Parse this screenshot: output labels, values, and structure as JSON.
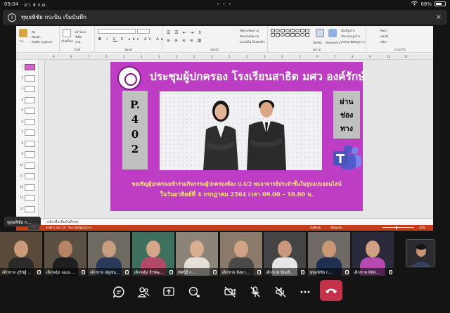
{
  "status_bar": {
    "time": "09:04",
    "date": "อา. 4 ก.ค.",
    "battery": "68%",
    "battery_level": 0.68
  },
  "banner": {
    "text": "ทุทฺธพิชัย กระบิน เริ่มบันทึก",
    "icon": "info-icon",
    "close": "×"
  },
  "ribbon": {
    "clipboard": {
      "paste": "วาง",
      "cut": "ตัด",
      "copy": "คัดลอก",
      "format_painter": "ตัวคัดวางรูปแบบ"
    },
    "slides": {
      "new_slide": "สไลด์ใหม่",
      "layout": "เค้าโครง",
      "reset": "รีเซ็ต",
      "section": "ส่วน",
      "label": "สไลด์"
    },
    "font": {
      "label": "ฟอนต์",
      "buttons": [
        "B",
        "I",
        "U",
        "S",
        "abc",
        "AV",
        "Aa"
      ]
    },
    "paragraph": {
      "label": "ย่อหน้า",
      "text_direction": "ทิศทางข้อความ",
      "align_text": "จัดแนวข้อความ",
      "smartart": "แปลงเป็น SmartArt"
    },
    "drawing": {
      "label": "รูปวาด",
      "arrange": "จัดเรียง",
      "quick_styles": "ลักษณะด่วน",
      "shape_fill": "เติมสีรูปร่าง",
      "shape_outline": "เส้นกรอบรูปร่าง",
      "shape_effects": "ลักษณะพิเศษรูปร่าง"
    },
    "editing": {
      "label": "การแก้ไข",
      "find": "ค้นหา",
      "replace": "แทนที่",
      "select": "เลือก"
    }
  },
  "ruler_numbers": [
    "9",
    "8",
    "7",
    "6",
    "5",
    "4",
    "3",
    "2",
    "1",
    "0",
    "1",
    "2",
    "3",
    "4",
    "5",
    "6",
    "7",
    "8",
    "9",
    "10",
    "11"
  ],
  "slide_thumbnails": [
    "1",
    "2",
    "3",
    "4",
    "5",
    "6",
    "7",
    "8",
    "9",
    "10",
    "11",
    "12",
    "13",
    "14"
  ],
  "active_thumbnail": "1",
  "slide": {
    "title": "ประชุมผู้ปกครอง โรงเรียนสาธิต มศว องค์รักษ์",
    "room_lines": [
      "P.",
      "4",
      "0",
      "2"
    ],
    "via_lines": [
      "ผ่าน",
      "ช่อง",
      "ทาง"
    ],
    "invite": "ขอเชิญผู้ปกครองเข้าร่วมกิจกรรมผู้ปกครองห้อง ป.4/2 พบอาจารย์ประจำชั้นในรูปแบบออนไลน์",
    "when": "ในวันอาทิตย์ที่ 4 กรกฎาคม 2564 เวลา 09.00 – 10.00 น.",
    "colors": {
      "background": "#bd3ec4",
      "title": "#ffffff",
      "accent_text": "#ffef66",
      "panel": "#c0c0c0"
    }
  },
  "notes_placeholder": "คลิกเพื่อเพิ่มบันทึกย่อ",
  "powerpoint_status": {
    "slide_info": "สไลด์ 1 จาก 14",
    "language": "ไทย (สหรัฐอเมริกา)",
    "notes": "บันทึกย่อ",
    "comments": "ข้อคิดเห็น",
    "zoom": "42%",
    "zoom_level": 0.42
  },
  "presenter": {
    "name": "ทุทฺธพิชัย ก...",
    "more": "..."
  },
  "participants": [
    {
      "name": "เด็กชาย ภูริชฐ์ ...",
      "colors": [
        "#5a4a3a",
        "#2b2b2b",
        "#c89a7a"
      ]
    },
    {
      "name": "เด็กหญิง ณมน ...",
      "colors": [
        "#5b5044",
        "#1e1e1e",
        "#b78367"
      ]
    },
    {
      "name": "เด็กชาย ณัฐชน...",
      "colors": [
        "#6e6a62",
        "#2a3a5a",
        "#c79d80"
      ]
    },
    {
      "name": "เด็กหญิง ธีรพัฒ...",
      "colors": [
        "#3f6f5f",
        "#b24a6a",
        "#d4a58a"
      ]
    },
    {
      "name": "ทัศนีย์ ก...",
      "colors": [
        "#8d8479",
        "#e7e0d8",
        "#d8ae90"
      ]
    },
    {
      "name": "เด็กชาย ลิงพา...",
      "colors": [
        "#8a7a6a",
        "#4a4a4a",
        "#d1a286"
      ]
    },
    {
      "name": "เด็กชาย ปัณฑ์...",
      "colors": [
        "#444444",
        "#e5e5e5",
        "#c8967a"
      ]
    },
    {
      "name": "ทุทฺธพิชัย ก...",
      "colors": [
        "#6f6a66",
        "#1f2f4f",
        "#c89877"
      ]
    },
    {
      "name": "เด็กชาย อิทัส...",
      "colors": [
        "#2a2a3a",
        "#b64ab0",
        "#cfa082"
      ]
    }
  ],
  "controls": [
    {
      "name": "chat-button",
      "icon": "chat-icon"
    },
    {
      "name": "participants-button",
      "icon": "people-icon"
    },
    {
      "name": "share-button",
      "icon": "share-screen-icon"
    },
    {
      "name": "reactions-button",
      "icon": "reactions-icon"
    },
    {
      "name": "camera-button",
      "icon": "camera-off-icon"
    },
    {
      "name": "mic-button",
      "icon": "mic-off-icon"
    },
    {
      "name": "speaker-button",
      "icon": "speaker-off-icon"
    },
    {
      "name": "more-button",
      "icon": "more-icon"
    },
    {
      "name": "hangup-button",
      "icon": "hangup-icon",
      "color": "#c4314b"
    }
  ]
}
